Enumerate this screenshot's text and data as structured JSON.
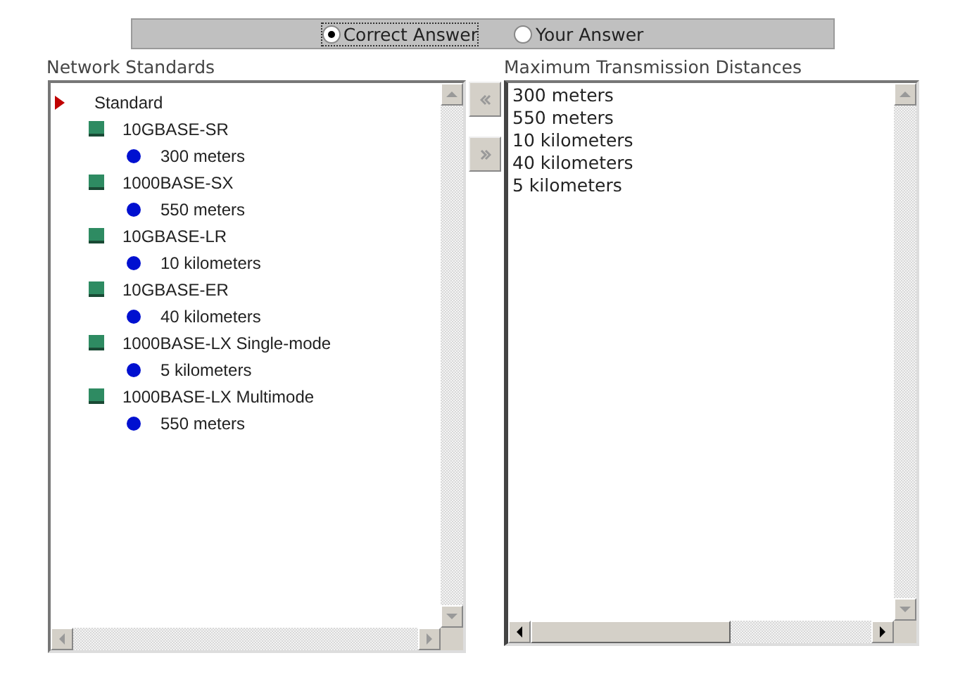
{
  "answer_toggle": [
    {
      "label": "Correct Answer",
      "selected": true
    },
    {
      "label": "Your Answer",
      "selected": false
    }
  ],
  "left_panel": {
    "title": "Network Standards",
    "tree": [
      {
        "label": "Standard",
        "kind": "root",
        "children": [
          {
            "label": "10GBASE-SR",
            "kind": "standard",
            "children": [
              {
                "label": "300 meters",
                "kind": "distance"
              }
            ]
          },
          {
            "label": "1000BASE-SX",
            "kind": "standard",
            "children": [
              {
                "label": "550 meters",
                "kind": "distance"
              }
            ]
          },
          {
            "label": "10GBASE-LR",
            "kind": "standard",
            "children": [
              {
                "label": "10 kilometers",
                "kind": "distance"
              }
            ]
          },
          {
            "label": "10GBASE-ER",
            "kind": "standard",
            "children": [
              {
                "label": "40 kilometers",
                "kind": "distance"
              }
            ]
          },
          {
            "label": "1000BASE-LX Single-mode",
            "kind": "standard",
            "children": [
              {
                "label": "5 kilometers",
                "kind": "distance"
              }
            ]
          },
          {
            "label": "1000BASE-LX Multimode",
            "kind": "standard",
            "children": [
              {
                "label": "550 meters",
                "kind": "distance"
              }
            ]
          }
        ]
      }
    ]
  },
  "move_buttons": [
    {
      "kind": "left"
    },
    {
      "kind": "right"
    }
  ],
  "right_panel": {
    "title": "Maximum Transmission Distances",
    "items": [
      "300 meters",
      "550 meters",
      "10 kilometers",
      "40 kilometers",
      "5 kilometers"
    ]
  }
}
